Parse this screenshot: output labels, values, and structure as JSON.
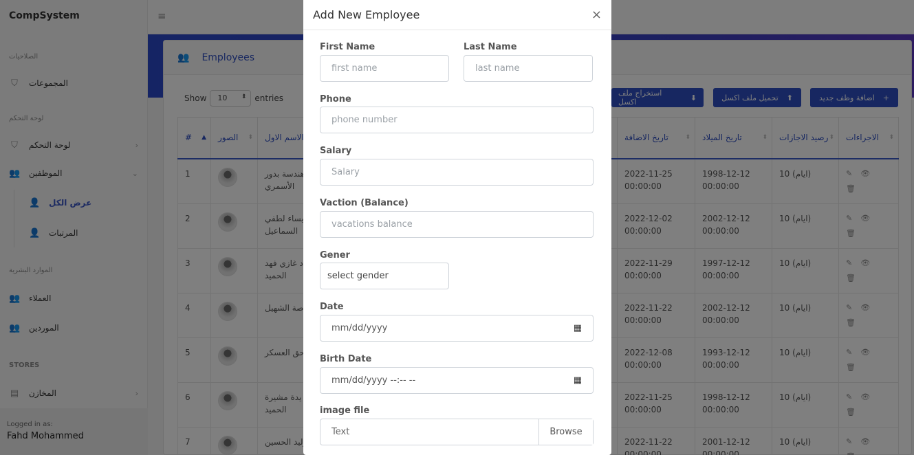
{
  "app": {
    "brand": "CompSystem",
    "menu_toggle": "≡"
  },
  "sidebar": {
    "sections": [
      {
        "heading": "الصلاحيات"
      },
      {
        "heading": "لوحة التحكم"
      },
      {
        "heading": "الموارد البشرية"
      },
      {
        "heading": "STORES"
      }
    ],
    "items": [
      {
        "label": "المجموعات",
        "icon": "shield-icon"
      },
      {
        "label": "لوحة التحكم",
        "icon": "shield-icon",
        "chevron": "›"
      },
      {
        "label": "الموظفين",
        "icon": "users-icon",
        "chevron": "⌄"
      },
      {
        "label": "عرض الكل",
        "icon": "user-plus-icon",
        "active": true
      },
      {
        "label": "المرتبات",
        "icon": "user-plus-icon"
      },
      {
        "label": "العملاء",
        "icon": "users-icon"
      },
      {
        "label": "الموردين",
        "icon": "users-icon"
      },
      {
        "label": "المخازن",
        "icon": "store-icon",
        "chevron": "›"
      }
    ],
    "footer": {
      "logged_in_label": "Logged in as:",
      "user": "Fahd Mohammed"
    }
  },
  "card": {
    "title": "Employees",
    "show_label": "Show",
    "entries_value": "10",
    "entries_label": "entries",
    "buttons": {
      "export": "استخراج ملف اكسل",
      "upload": "تحميل ملف اكسل",
      "add": "اضافة وظف جديد"
    }
  },
  "table": {
    "headers": [
      "#",
      "الصور",
      "الاسم الاول",
      "تاريخ الاضافة",
      "تاريخ الميلاد",
      "رصيد الاجازات",
      "الاجراءات"
    ],
    "rows": [
      {
        "id": "1",
        "name1": "هندسة بدور",
        "name2": "الأسمري",
        "added1": "2022-11-25",
        "added2": "00:00:00",
        "birth1": "1998-12-12",
        "birth2": "00:00:00",
        "vac": "10 (ايام)"
      },
      {
        "id": "2",
        "name1": "يساء لطفي",
        "name2": "السماعيل",
        "added1": "2022-12-02",
        "added2": "00:00:00",
        "birth1": "2002-12-12",
        "birth2": "00:00:00",
        "vac": "10 (ايام)"
      },
      {
        "id": "3",
        "name1": "اد غازي فهد",
        "name2": "الحميد",
        "added1": "2022-11-29",
        "added2": "00:00:00",
        "birth1": "1997-12-12",
        "birth2": "00:00:00",
        "vac": "10 (ايام)"
      },
      {
        "id": "4",
        "name1": "صة الشهيل",
        "name2": "",
        "added1": "2022-11-22",
        "added2": "00:00:00",
        "birth1": "2002-12-12",
        "birth2": "00:00:00",
        "vac": "10 (ايام)"
      },
      {
        "id": "5",
        "name1": "حق العسكر",
        "name2": "",
        "added1": "2022-12-08",
        "added2": "00:00:00",
        "birth1": "1993-12-12",
        "birth2": "00:00:00",
        "vac": "10 (ايام)"
      },
      {
        "id": "6",
        "name1": "يدة مشيرة",
        "name2": "الحميد",
        "added1": "2022-11-25",
        "added2": "00:00:00",
        "birth1": "1998-12-12",
        "birth2": "00:00:00",
        "vac": "10 (ايام)"
      },
      {
        "id": "7",
        "name1": "وليد الحسين",
        "name2": "",
        "added1": "2022-11-22",
        "added2": "00:00:00",
        "birth1": "2001-12-12",
        "birth2": "00:00:00",
        "vac": "10 (ايام)"
      }
    ]
  },
  "modal": {
    "title": "Add New Employee",
    "close": "×",
    "fields": {
      "first_name": {
        "label": "First Name",
        "placeholder": "first name"
      },
      "last_name": {
        "label": "Last Name",
        "placeholder": "last name"
      },
      "phone": {
        "label": "Phone",
        "placeholder": "phone number"
      },
      "salary": {
        "label": "Salary",
        "placeholder": "Salary"
      },
      "vacation": {
        "label": "Vaction (Balance)",
        "placeholder": "vacations balance"
      },
      "gender": {
        "label": "Gener",
        "value": "select gender"
      },
      "date": {
        "label": "Date",
        "placeholder": "mm/dd/yyyy"
      },
      "birth_date": {
        "label": "Birth Date",
        "placeholder": "mm/dd/yyyy --:-- --"
      },
      "image": {
        "label": "image file",
        "placeholder": "Text",
        "browse": "Browse"
      }
    }
  },
  "colors": {
    "primary": "#2e4fc2",
    "overlay": "rgba(0,0,0,0.5)"
  }
}
